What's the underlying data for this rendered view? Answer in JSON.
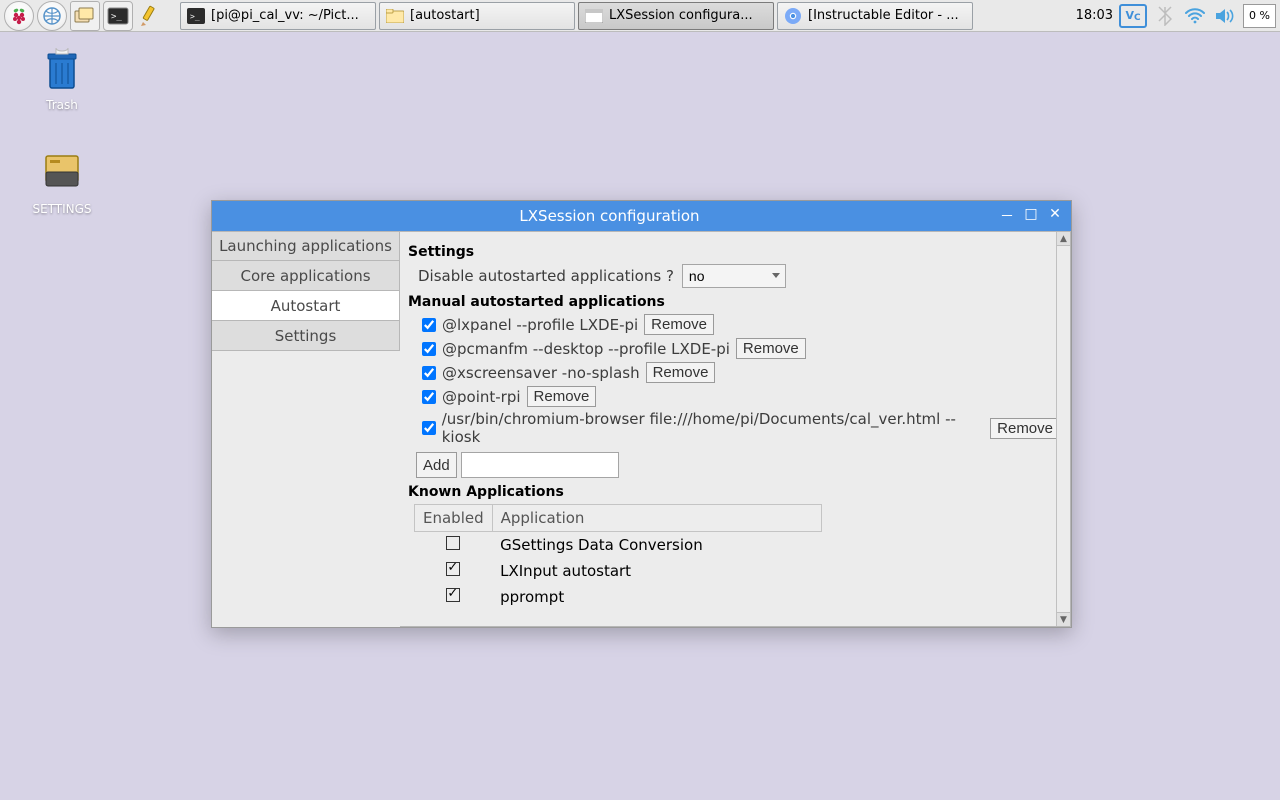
{
  "taskbar": {
    "launchers": [
      {
        "name": "raspberry-menu",
        "icon": "raspberry"
      },
      {
        "name": "web-browser",
        "icon": "globe"
      },
      {
        "name": "file-manager",
        "icon": "folders"
      },
      {
        "name": "terminal",
        "icon": "terminal"
      },
      {
        "name": "text-editor",
        "icon": "pencil"
      }
    ],
    "tasks": [
      {
        "name": "task-terminal",
        "icon": "terminal",
        "label": "[pi@pi_cal_vv: ~/Pict...",
        "active": false
      },
      {
        "name": "task-autostart",
        "icon": "folder",
        "label": "[autostart]",
        "active": false
      },
      {
        "name": "task-lxsession",
        "icon": "window",
        "label": "LXSession configura...",
        "active": true
      },
      {
        "name": "task-chromium",
        "icon": "chromium",
        "label": "[Instructable Editor - ...",
        "active": false
      }
    ],
    "tray": {
      "clock": "18:03",
      "cpu": "0 %"
    }
  },
  "desktop": {
    "icons": [
      {
        "name": "trash",
        "label": "Trash",
        "glyph": "🗑️"
      },
      {
        "name": "settings",
        "label": "SETTINGS",
        "glyph": "📇"
      }
    ]
  },
  "window": {
    "title": "LXSession configuration",
    "tabs": [
      {
        "key": "launching",
        "label": "Launching applications"
      },
      {
        "key": "core",
        "label": "Core applications"
      },
      {
        "key": "autostart",
        "label": "Autostart",
        "active": true
      },
      {
        "key": "settings",
        "label": "Settings"
      }
    ],
    "settings_heading": "Settings",
    "disable_label": "Disable autostarted applications ?",
    "disable_value": "no",
    "manual_heading": "Manual autostarted applications",
    "manual_items": [
      {
        "checked": true,
        "label": "@lxpanel --profile LXDE-pi"
      },
      {
        "checked": true,
        "label": "@pcmanfm --desktop --profile LXDE-pi"
      },
      {
        "checked": true,
        "label": "@xscreensaver -no-splash"
      },
      {
        "checked": true,
        "label": "@point-rpi"
      },
      {
        "checked": true,
        "label": "/usr/bin/chromium-browser file:///home/pi/Documents/cal_ver.html --kiosk"
      }
    ],
    "remove_label": "Remove",
    "add_label": "Add",
    "add_value": "",
    "known_heading": "Known Applications",
    "known_cols": {
      "enabled": "Enabled",
      "application": "Application"
    },
    "known_rows": [
      {
        "enabled": false,
        "label": "GSettings Data Conversion"
      },
      {
        "enabled": true,
        "label": "LXInput autostart"
      },
      {
        "enabled": true,
        "label": "pprompt"
      }
    ]
  }
}
